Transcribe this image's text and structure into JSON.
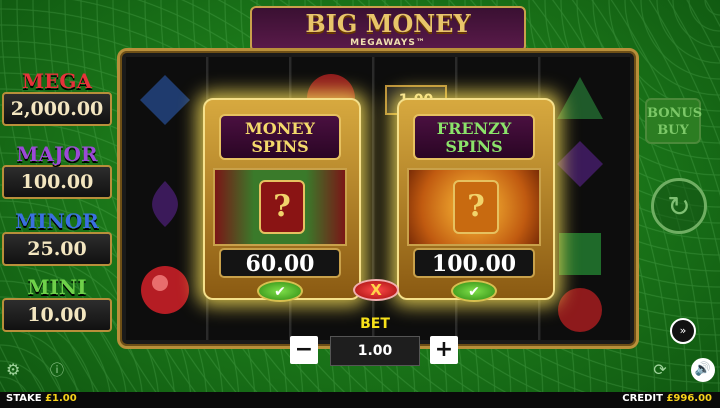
{
  "logo": {
    "title": "BIG MONEY",
    "subtitle": "MEGAWAYS™"
  },
  "jackpots": [
    {
      "name": "MEGA",
      "value": "2,000.00",
      "color": "#e6333a"
    },
    {
      "name": "MAJOR",
      "value": "100.00",
      "color": "#9b4ad6"
    },
    {
      "name": "MINOR",
      "value": "25.00",
      "color": "#3a6fe0"
    },
    {
      "name": "MINI",
      "value": "10.00",
      "color": "#6fd14a"
    }
  ],
  "cards": [
    {
      "title_line1": "MONEY",
      "title_line2": "SPINS",
      "title_color": "#f4d96b",
      "price": "60.00",
      "confirm_icon": "check-icon"
    },
    {
      "title_line1": "FRENZY",
      "title_line2": "SPINS",
      "title_color": "#8be36a",
      "price": "100.00",
      "confirm_icon": "check-icon"
    }
  ],
  "close_label": "X",
  "bonus_buy": {
    "line1": "BONUS",
    "line2": "BUY"
  },
  "bet": {
    "label": "BET",
    "value": "1.00",
    "minus": "−",
    "plus": "+"
  },
  "footer": {
    "stake_label": "STAKE",
    "stake_value": "£1.00",
    "credit_label": "CREDIT",
    "credit_value": "£996.00"
  },
  "icons": {
    "spin": "refresh-icon",
    "turbo": "fast-forward-icon",
    "sound": "speaker-icon",
    "autoplay": "autoplay-icon",
    "settings": "settings-icon",
    "info": "info-icon"
  }
}
